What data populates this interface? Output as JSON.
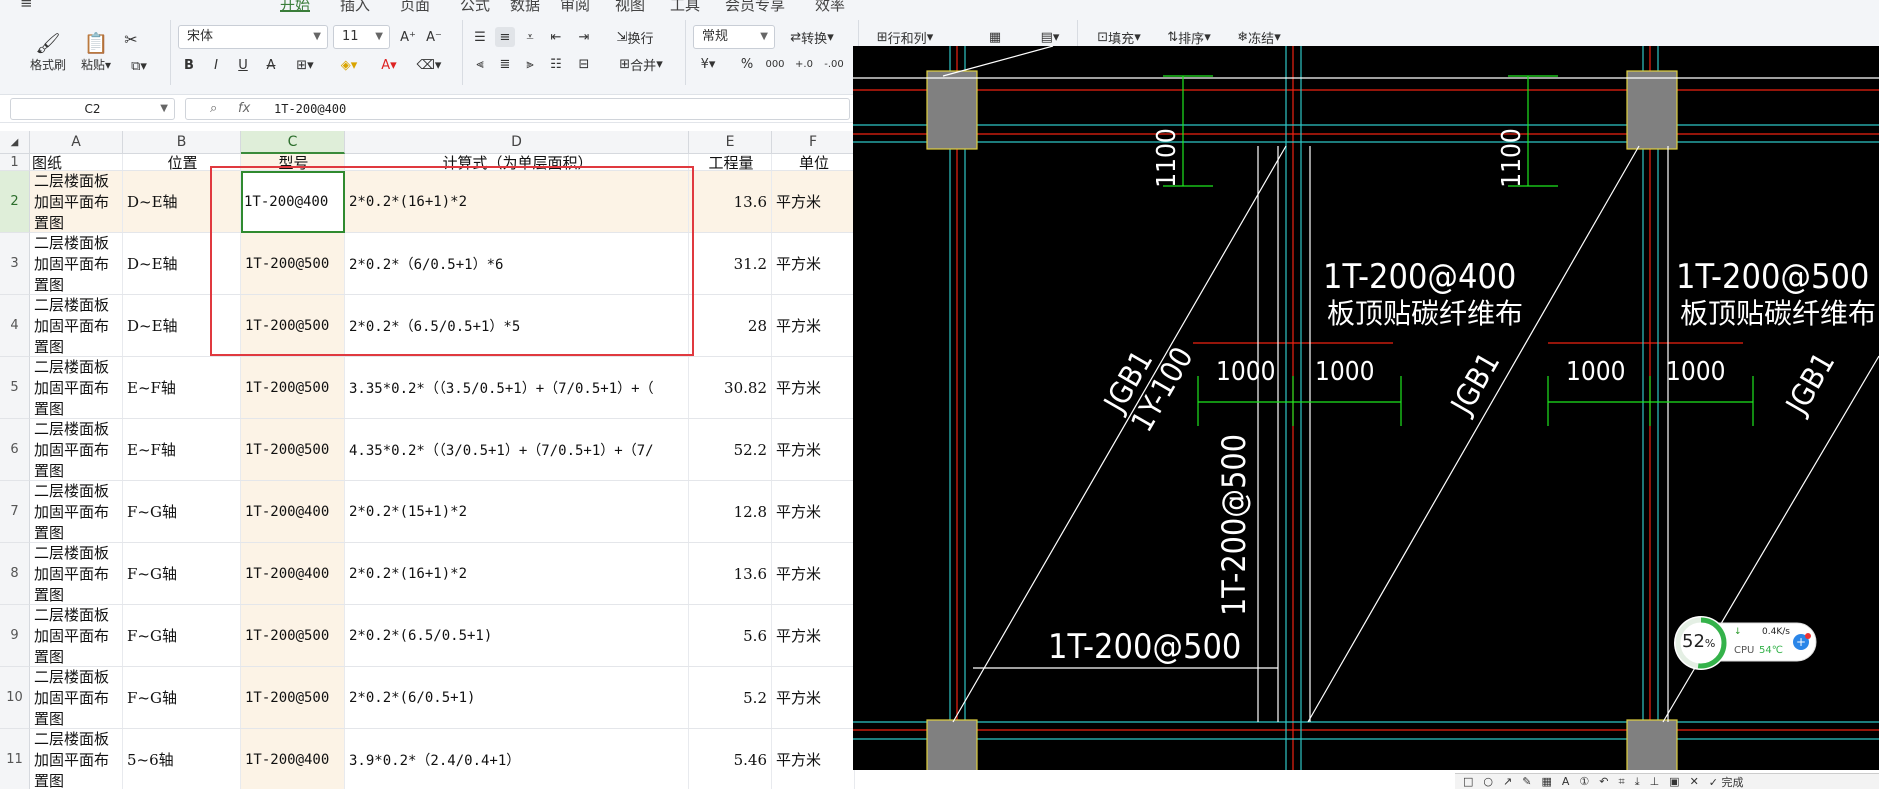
{
  "ribbon": {
    "tabs": [
      "开始",
      "插入",
      "页面",
      "公式",
      "数据",
      "审阅",
      "视图",
      "工具",
      "会员专享",
      "效率"
    ],
    "active_tab": "开始",
    "format_painter": "格式刷",
    "paste": "粘贴",
    "font_name": "宋体",
    "font_size": "11",
    "wrap_text": "换行",
    "merge": "合并",
    "number_format": "常规",
    "convert": "转换",
    "rows_cols": "行和列",
    "fill": "填充",
    "sort": "排序",
    "freeze": "冻结",
    "bold": "B",
    "italic": "I",
    "underline": "U",
    "strike": "A",
    "currency": "¥",
    "percent": "%",
    "thousands": "000",
    "dec_inc": "+.0",
    "dec_dec": "-.00"
  },
  "formula_bar": {
    "cell_ref": "C2",
    "fx": "fx",
    "value": "1T-200@400"
  },
  "sheet": {
    "columns": [
      "A",
      "B",
      "C",
      "D",
      "E",
      "F"
    ],
    "header": {
      "A": "图纸",
      "B": "位置",
      "C": "型号",
      "D": "计算式（为单层面积）",
      "E": "工程量",
      "F": "单位"
    },
    "rows": [
      {
        "n": "2",
        "a": "二层楼面板加固平面布置图",
        "b": "D~E轴",
        "c": "1T-200@400",
        "d": "2*0.2*(16+1)*2",
        "e": "13.6",
        "f": "平方米"
      },
      {
        "n": "3",
        "a": "二层楼面板加固平面布置图",
        "b": "D~E轴",
        "c": "1T-200@500",
        "d": "2*0.2*（6/0.5+1）*6",
        "e": "31.2",
        "f": "平方米"
      },
      {
        "n": "4",
        "a": "二层楼面板加固平面布置图",
        "b": "D~E轴",
        "c": "1T-200@500",
        "d": "2*0.2*（6.5/0.5+1）*5",
        "e": "28",
        "f": "平方米"
      },
      {
        "n": "5",
        "a": "二层楼面板加固平面布置图",
        "b": "E~F轴",
        "c": "1T-200@500",
        "d": "3.35*0.2*（（3.5/0.5+1）+（7/0.5+1）+（",
        "e": "30.82",
        "f": "平方米"
      },
      {
        "n": "6",
        "a": "二层楼面板加固平面布置图",
        "b": "E~F轴",
        "c": "1T-200@500",
        "d": "4.35*0.2*（（3/0.5+1）+（7/0.5+1）+（7/",
        "e": "52.2",
        "f": "平方米"
      },
      {
        "n": "7",
        "a": "二层楼面板加固平面布置图",
        "b": "F~G轴",
        "c": "1T-200@400",
        "d": "2*0.2*(15+1)*2",
        "e": "12.8",
        "f": "平方米"
      },
      {
        "n": "8",
        "a": "二层楼面板加固平面布置图",
        "b": "F~G轴",
        "c": "1T-200@400",
        "d": "2*0.2*(16+1)*2",
        "e": "13.6",
        "f": "平方米"
      },
      {
        "n": "9",
        "a": "二层楼面板加固平面布置图",
        "b": "F~G轴",
        "c": "1T-200@500",
        "d": "2*0.2*(6.5/0.5+1)",
        "e": "5.6",
        "f": "平方米"
      },
      {
        "n": "10",
        "a": "二层楼面板加固平面布置图",
        "b": "F~G轴",
        "c": "1T-200@500",
        "d": "2*0.2*(6/0.5+1)",
        "e": "5.2",
        "f": "平方米"
      },
      {
        "n": "11",
        "a": "二层楼面板加固平面布置图",
        "b": "5~6轴",
        "c": "1T-200@400",
        "d": "3.9*0.2*（2.4/0.4+1）",
        "e": "5.46",
        "f": "平方米"
      }
    ]
  },
  "cad": {
    "dim_1100_a": "1100",
    "dim_1100_b": "1100",
    "label_400": "1T-200@400",
    "label_400_sub": "板顶贴碳纤维布",
    "label_500": "1T-200@500",
    "label_500_sub": "板顶贴碳纤维布",
    "dim_1000": "1000",
    "jgb1": "JGB1",
    "y100": "1Y-100",
    "vertical_label": "1T-200@500",
    "bottom_label": "1T-200@500"
  },
  "widget": {
    "cpu_percent": "52",
    "percent_sign": "%",
    "net_speed": "0.4K/s",
    "cpu_label": "CPU",
    "cpu_temp": "54℃"
  },
  "snip_toolbar": {
    "done": "完成"
  }
}
